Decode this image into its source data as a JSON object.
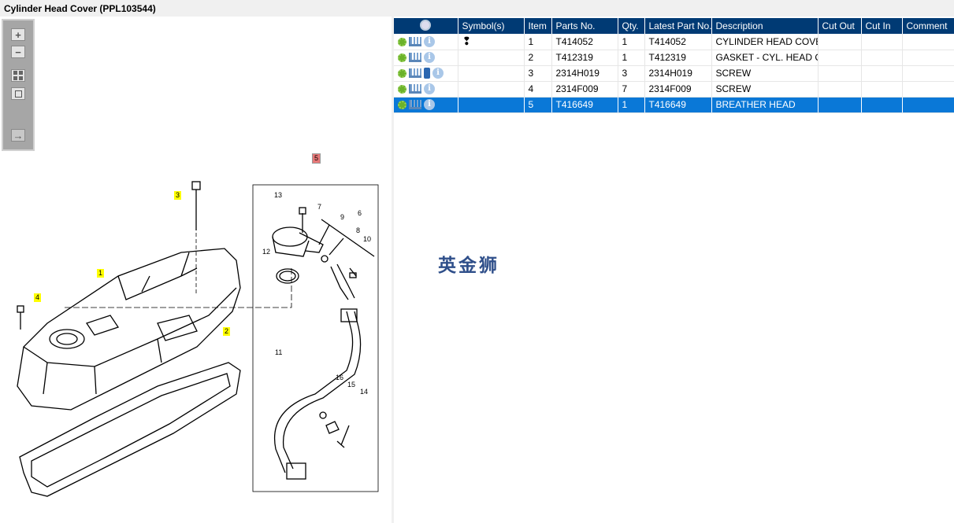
{
  "title": "Cylinder Head Cover (PPL103544)",
  "toolbar": {
    "icons": [
      "zoom-in-icon",
      "zoom-out-icon",
      "fit-all-icon",
      "fit-window-icon",
      "export-icon"
    ],
    "zoom_in": "+",
    "zoom_out": "−"
  },
  "table": {
    "headers": [
      "",
      "Symbol(s)",
      "Item",
      "Parts No.",
      "Qty.",
      "Latest Part No.",
      "Description",
      "Cut Out",
      "Cut In",
      "Comment"
    ],
    "rows": [
      {
        "item": "1",
        "parts_no": "T414052",
        "qty": "1",
        "latest": "T414052",
        "desc": "CYLINDER HEAD COVER",
        "symbol": "❢"
      },
      {
        "item": "2",
        "parts_no": "T412319",
        "qty": "1",
        "latest": "T412319",
        "desc": "GASKET - CYL. HEAD COVER",
        "symbol": ""
      },
      {
        "item": "3",
        "parts_no": "2314H019",
        "qty": "3",
        "latest": "2314H019",
        "desc": "SCREW",
        "symbol": ""
      },
      {
        "item": "4",
        "parts_no": "2314F009",
        "qty": "7",
        "latest": "2314F009",
        "desc": "SCREW",
        "symbol": ""
      },
      {
        "item": "5",
        "parts_no": "T416649",
        "qty": "1",
        "latest": "T416649",
        "desc": "BREATHER HEAD",
        "symbol": ""
      }
    ],
    "info_glyph": "i",
    "selected_item": "5",
    "selected_color": "#0a78d7",
    "header_color": "#003a74"
  },
  "watermark": "英金狮",
  "diagram": {
    "callouts": [
      "3",
      "1",
      "4",
      "2",
      "5",
      "13",
      "7",
      "9",
      "6",
      "8",
      "10",
      "12",
      "11",
      "16",
      "15",
      "14"
    ]
  }
}
